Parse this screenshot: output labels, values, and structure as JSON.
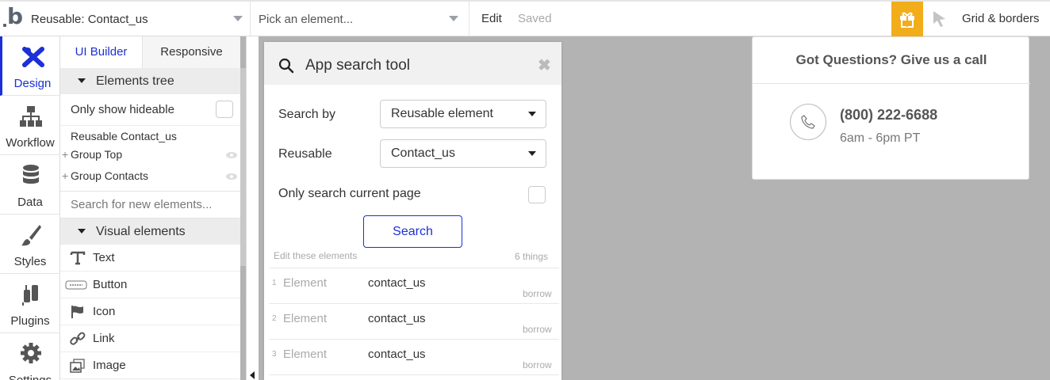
{
  "topbar": {
    "page_selector": "Reusable: Contact_us",
    "element_selector": "Pick an element...",
    "edit_label": "Edit",
    "status_label": "Saved",
    "grid_label": "Grid & borders",
    "accent_color": "#f2ad1b"
  },
  "leftnav": {
    "items": [
      {
        "label": "Design",
        "icon": "design-icon",
        "active": true
      },
      {
        "label": "Workflow",
        "icon": "workflow-icon"
      },
      {
        "label": "Data",
        "icon": "database-icon"
      },
      {
        "label": "Styles",
        "icon": "brush-icon"
      },
      {
        "label": "Plugins",
        "icon": "plug-icon"
      },
      {
        "label": "Settings",
        "icon": "gear-icon"
      }
    ]
  },
  "panel": {
    "tabs": [
      "UI Builder",
      "Responsive"
    ],
    "elements_tree_title": "Elements tree",
    "only_hideable_label": "Only show hideable",
    "tree": [
      {
        "label": "Reusable Contact_us"
      },
      {
        "label": "Group Top"
      },
      {
        "label": "Group Contacts"
      }
    ],
    "search_placeholder": "Search for new elements...",
    "visual_elements_title": "Visual elements",
    "visual_elements": [
      {
        "label": "Text",
        "icon": "text-icon"
      },
      {
        "label": "Button",
        "icon": "button-icon"
      },
      {
        "label": "Icon",
        "icon": "flag-icon"
      },
      {
        "label": "Link",
        "icon": "link-icon"
      },
      {
        "label": "Image",
        "icon": "image-icon"
      }
    ]
  },
  "search_tool": {
    "title": "App search tool",
    "search_by_label": "Search by",
    "search_by_value": "Reusable element",
    "reusable_label": "Reusable",
    "reusable_value": "Contact_us",
    "only_current_label": "Only search current page",
    "search_button": "Search",
    "edit_these_label": "Edit these elements",
    "count_label": "6 things",
    "results": [
      {
        "num": "1",
        "type": "Element",
        "name": "contact_us",
        "action": "borrow"
      },
      {
        "num": "2",
        "type": "Element",
        "name": "contact_us",
        "action": "borrow"
      },
      {
        "num": "3",
        "type": "Element",
        "name": "contact_us",
        "action": "borrow"
      }
    ]
  },
  "help_popup": {
    "title": "Got Questions? Give us a call",
    "phone": "(800) 222-6688",
    "hours": "6am - 6pm PT"
  }
}
